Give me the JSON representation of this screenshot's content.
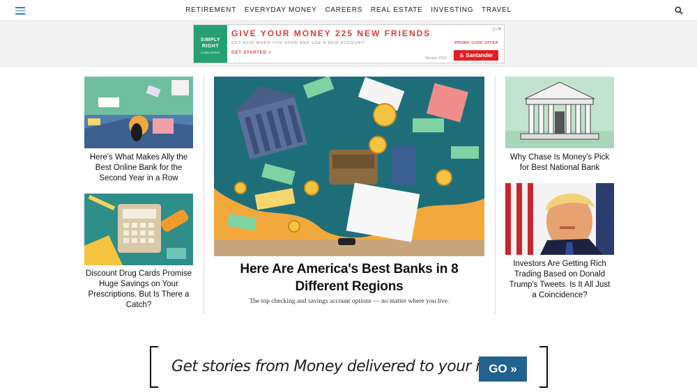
{
  "nav": {
    "menu_icon": "hamburger-icon",
    "links": [
      "RETIREMENT",
      "EVERYDAY MONEY",
      "CAREERS",
      "REAL ESTATE",
      "INVESTING",
      "TRAVEL"
    ],
    "search_icon": "search-icon"
  },
  "ad": {
    "logo_line1": "SIMPLY",
    "logo_line2": "RIGHT",
    "logo_line3": "CHECKING",
    "headline": "GIVE YOUR MONEY 225 NEW FRIENDS",
    "subline": "GET $225 WHEN YOU OPEN AND USE A NEW ACCOUNT.",
    "cta": "GET STARTED »",
    "promo": "PROMO CODE OFFER",
    "fdic": "Member FDIC",
    "brand": "Santander",
    "close_icon": "ad-choices-icon"
  },
  "stories": {
    "left_top": "Here's What Makes Ally the Best Online Bank for the Second Year in a Row",
    "left_bottom": "Discount Drug Cards Promise Huge Savings on Your Prescriptions. But Is There a Catch?",
    "main_title": "Here Are America's Best Banks in 8 Different Regions",
    "main_dek": "The top checking and savings account options — no matter where you live.",
    "right_top": "Why Chase Is Money's Pick for Best National Bank",
    "right_bottom": "Investors Are Getting Rich Trading Based on Donald Trump's Tweets. Is It All Just a Coincidence?"
  },
  "newsletter": {
    "text": "Get stories from Money delivered to your inbox",
    "button": "GO »"
  },
  "colors": {
    "accent_blue": "#21628f",
    "ad_red": "#d83e3e",
    "ad_green": "#26a072",
    "illustration_teal": "#1e6e7a",
    "illustration_orange": "#f3a83b"
  }
}
